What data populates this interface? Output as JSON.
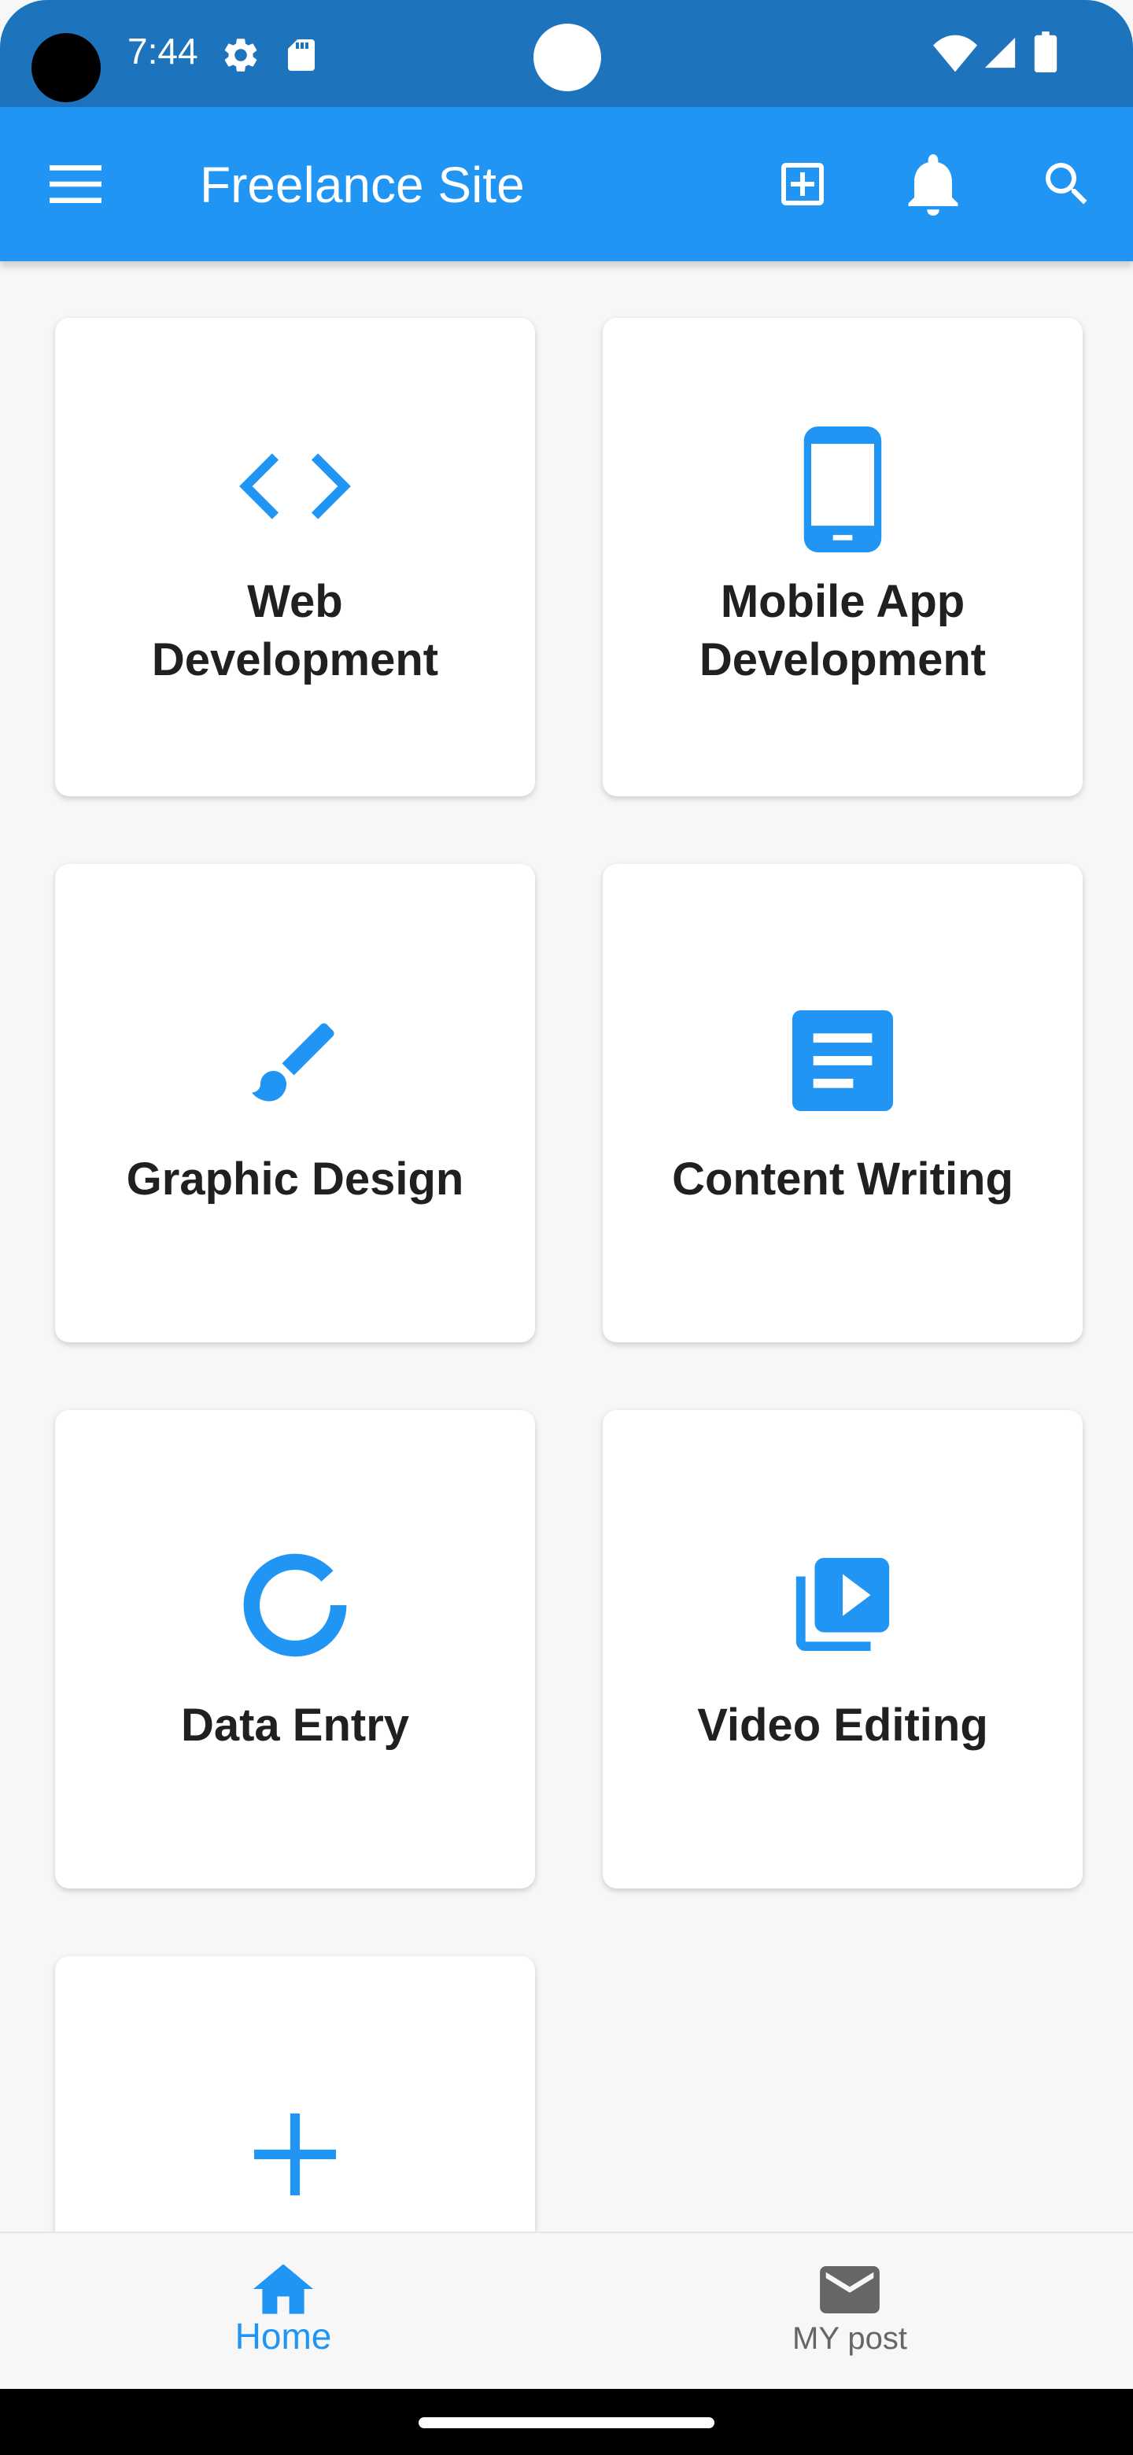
{
  "status_bar": {
    "time": "7:44",
    "icons": [
      "settings-icon",
      "sd-card-icon",
      "wifi-icon",
      "signal-icon",
      "battery-icon"
    ]
  },
  "app_bar": {
    "title": "Freelance Site",
    "icons": [
      "menu-icon",
      "add-box-icon",
      "notification-bell-icon",
      "search-icon"
    ]
  },
  "categories": [
    {
      "label_lines": [
        "Web",
        "Development"
      ],
      "icon": "code-icon"
    },
    {
      "label_lines": [
        "Mobile App",
        "Development"
      ],
      "icon": "smartphone-icon"
    },
    {
      "label_lines": [
        "Graphic Design"
      ],
      "icon": "brush-icon"
    },
    {
      "label_lines": [
        "Content Writing"
      ],
      "icon": "article-icon"
    },
    {
      "label_lines": [
        "Data Entry"
      ],
      "icon": "donut-icon"
    },
    {
      "label_lines": [
        "Video Editing"
      ],
      "icon": "video-library-icon"
    },
    {
      "label_lines": [],
      "icon": "add-icon"
    }
  ],
  "bottom_nav": {
    "items": [
      {
        "label": "Home",
        "icon": "home-icon",
        "active": true
      },
      {
        "label": "MY post",
        "icon": "mail-icon",
        "active": false
      }
    ]
  },
  "colors": {
    "primary": "#2195f3",
    "status_bar": "#1e73bd",
    "inactive": "#666666"
  }
}
